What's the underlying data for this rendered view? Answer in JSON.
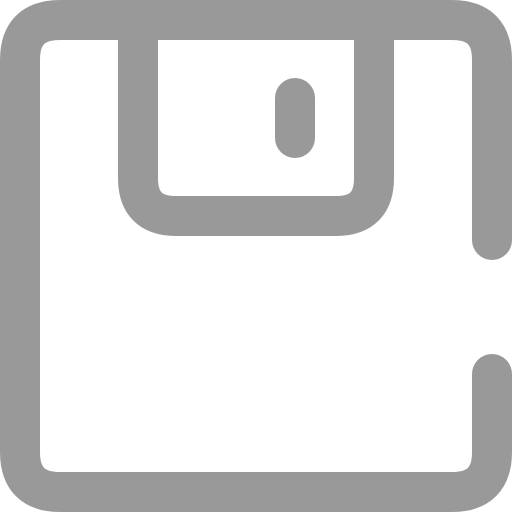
{
  "icon": {
    "name": "save-icon",
    "stroke_color": "#999999",
    "background_color": "#ffffff"
  }
}
